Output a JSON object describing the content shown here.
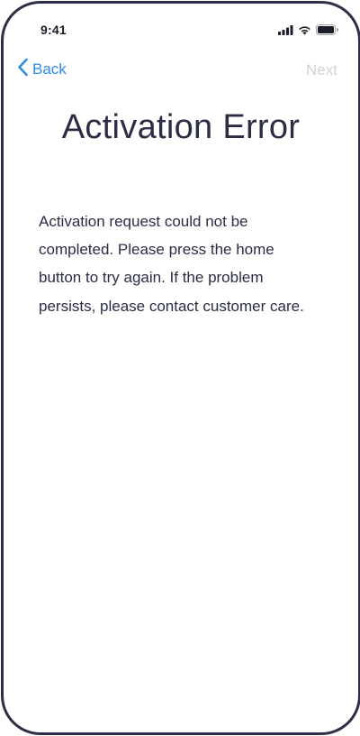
{
  "status_bar": {
    "time": "9:41"
  },
  "nav": {
    "back_label": "Back",
    "next_label": "Next"
  },
  "content": {
    "title": "Activation Error",
    "message": "Activation request could not be completed. Please press the home button to try again. If the problem persists, please contact customer care."
  },
  "colors": {
    "accent": "#2f8be8",
    "disabled": "#d0d3d9",
    "text": "#2a2d45",
    "frame": "#2c3047"
  },
  "icons": [
    "cellular-signal-icon",
    "wifi-icon",
    "battery-icon",
    "chevron-left-icon"
  ]
}
